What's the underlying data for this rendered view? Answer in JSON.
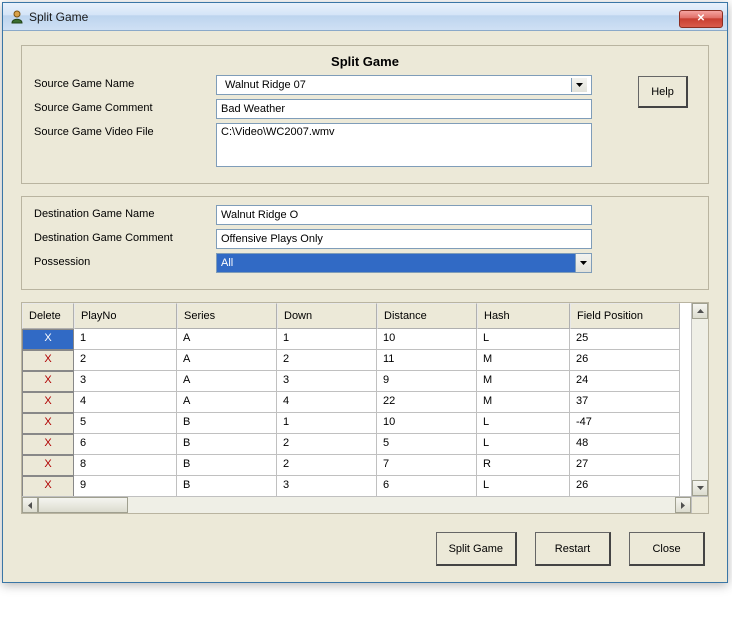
{
  "window": {
    "title": "Split Game",
    "close_symbol": "✕"
  },
  "header": {
    "title": "Split Game",
    "help_label": "Help"
  },
  "source": {
    "labels": {
      "name": "Source Game Name",
      "comment": "Source Game Comment",
      "video": "Source Game Video File"
    },
    "name_value": "Walnut Ridge 07",
    "comment_value": "Bad Weather",
    "video_value": "C:\\Video\\WC2007.wmv"
  },
  "destination": {
    "labels": {
      "name": "Destination Game Name",
      "comment": "Destination Game Comment",
      "possession": "Possession"
    },
    "name_value": "Walnut Ridge O",
    "comment_value": "Offensive Plays Only",
    "possession_value": "All"
  },
  "table": {
    "columns": [
      "Delete",
      "PlayNo",
      "Series",
      "Down",
      "Distance",
      "Hash",
      "Field Position"
    ],
    "delete_symbol": "X",
    "rows": [
      {
        "selected": true,
        "playno": "1",
        "series": "A",
        "down": "1",
        "distance": "10",
        "hash": "L",
        "fieldpos": "25"
      },
      {
        "selected": false,
        "playno": "2",
        "series": "A",
        "down": "2",
        "distance": "11",
        "hash": "M",
        "fieldpos": "26"
      },
      {
        "selected": false,
        "playno": "3",
        "series": "A",
        "down": "3",
        "distance": "9",
        "hash": "M",
        "fieldpos": "24"
      },
      {
        "selected": false,
        "playno": "4",
        "series": "A",
        "down": "4",
        "distance": "22",
        "hash": "M",
        "fieldpos": "37"
      },
      {
        "selected": false,
        "playno": "5",
        "series": "B",
        "down": "1",
        "distance": "10",
        "hash": "L",
        "fieldpos": "-47"
      },
      {
        "selected": false,
        "playno": "6",
        "series": "B",
        "down": "2",
        "distance": "5",
        "hash": "L",
        "fieldpos": "48"
      },
      {
        "selected": false,
        "playno": "8",
        "series": "B",
        "down": "2",
        "distance": "7",
        "hash": "R",
        "fieldpos": "27"
      },
      {
        "selected": false,
        "playno": "9",
        "series": "B",
        "down": "3",
        "distance": "6",
        "hash": "L",
        "fieldpos": "26"
      }
    ]
  },
  "footer": {
    "split_label": "Split Game",
    "restart_label": "Restart",
    "close_label": "Close"
  }
}
